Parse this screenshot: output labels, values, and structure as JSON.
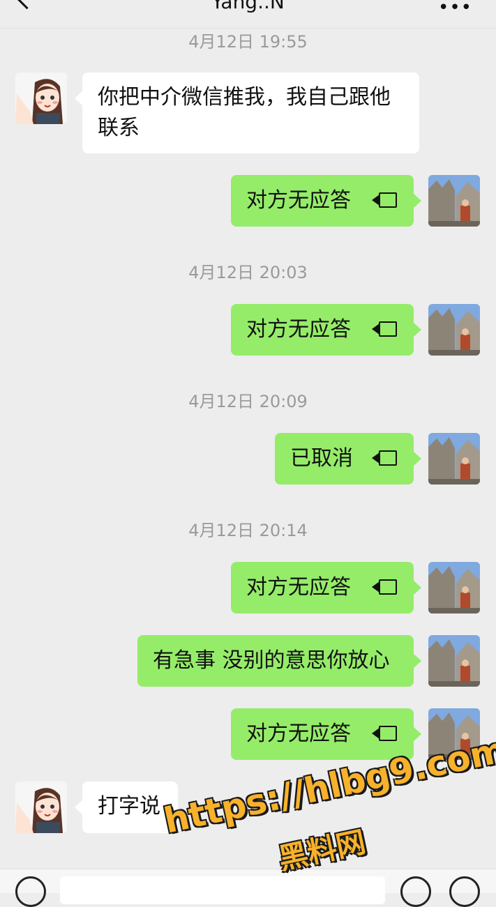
{
  "header": {
    "title": "Yang..N",
    "back_icon": "chevron-left-icon",
    "more_icon": "ellipsis-icon"
  },
  "messages": [
    {
      "kind": "timestamp",
      "text": "4月12日 19:55"
    },
    {
      "kind": "incoming",
      "text": "你把中介微信推我，我自己跟他联系"
    },
    {
      "kind": "outgoing-call",
      "text": "对方无应答",
      "icon": "video-call-icon"
    },
    {
      "kind": "timestamp",
      "text": "4月12日 20:03"
    },
    {
      "kind": "outgoing-call",
      "text": "对方无应答",
      "icon": "video-call-icon"
    },
    {
      "kind": "timestamp",
      "text": "4月12日 20:09"
    },
    {
      "kind": "outgoing-call",
      "text": "已取消",
      "icon": "video-call-icon"
    },
    {
      "kind": "timestamp",
      "text": "4月12日 20:14"
    },
    {
      "kind": "outgoing-call",
      "text": "对方无应答",
      "icon": "video-call-icon"
    },
    {
      "kind": "outgoing",
      "text": "有急事 没别的意思你放心"
    },
    {
      "kind": "outgoing-call",
      "text": "对方无应答",
      "icon": "video-call-icon"
    },
    {
      "kind": "incoming",
      "text": "打字说"
    }
  ],
  "watermark": {
    "url": "https://hlbg9.com",
    "name": "黑料网"
  },
  "colors": {
    "outgoing_bubble": "#95ec69",
    "incoming_bubble": "#ffffff",
    "background": "#ededed",
    "timestamp": "#9a9a9a"
  },
  "input_bar": {
    "voice_icon": "voice-icon",
    "emoji_icon": "emoji-icon",
    "plus_icon": "plus-icon"
  }
}
